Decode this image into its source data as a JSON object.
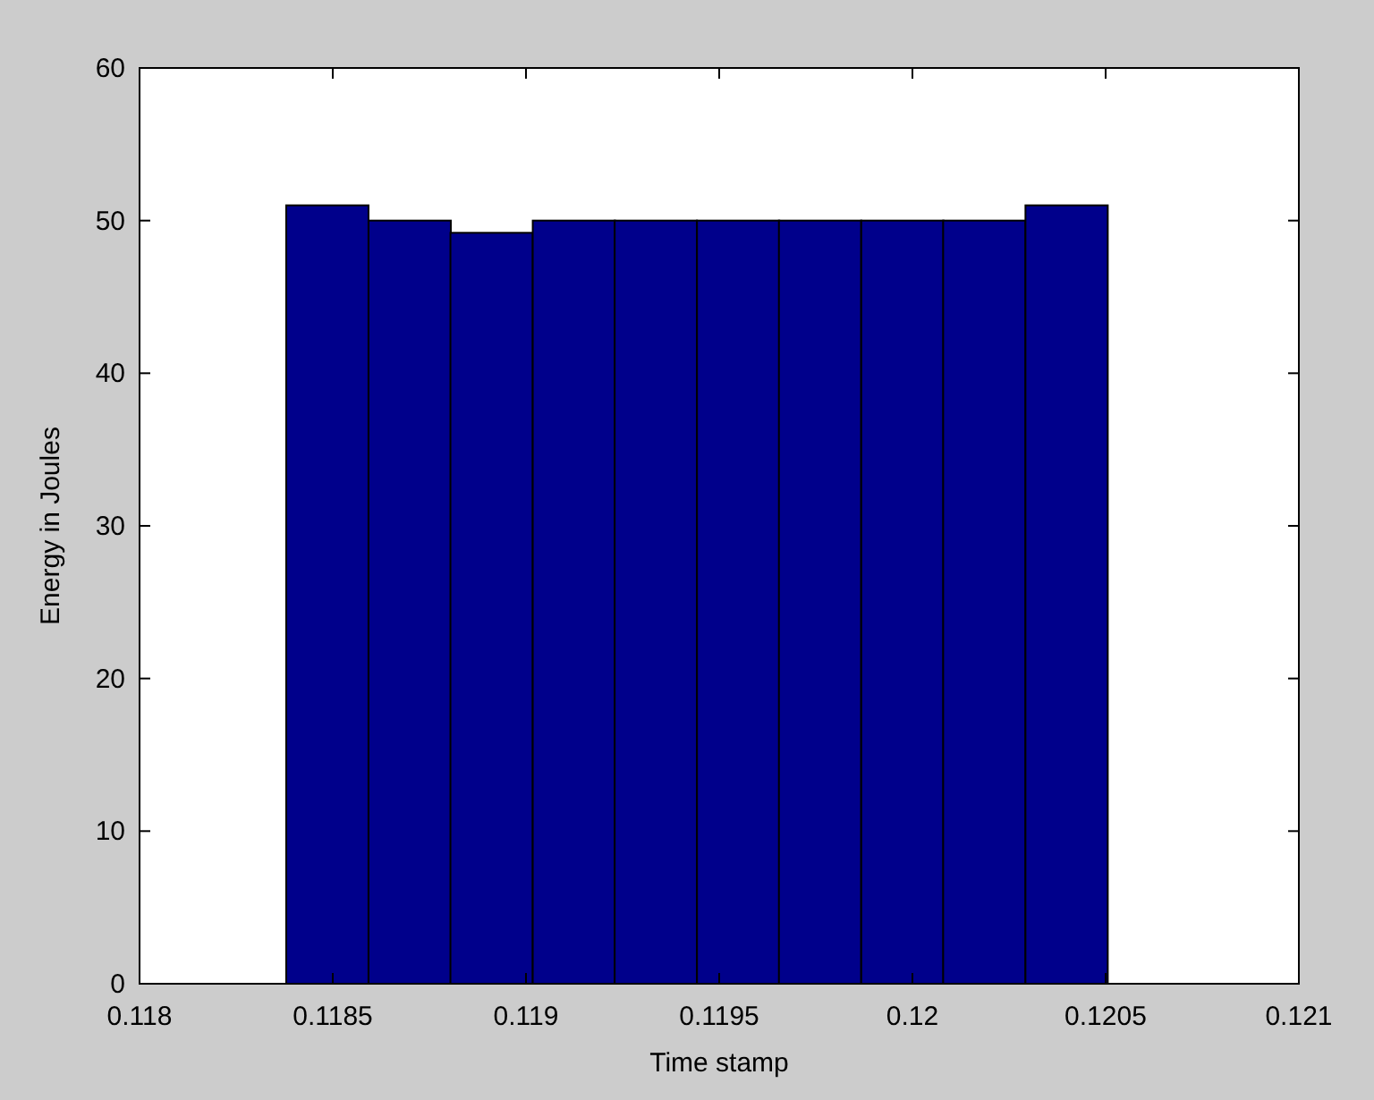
{
  "chart_data": {
    "type": "bar",
    "xlabel": "Time stamp",
    "ylabel": "Energy in Joules",
    "x": [
      0.118486,
      0.118699,
      0.118911,
      0.119124,
      0.119336,
      0.119549,
      0.119761,
      0.119974,
      0.120186,
      0.120399
    ],
    "series": [
      {
        "color": "#00008b",
        "values": [
          51,
          50,
          49.2,
          50,
          50,
          50,
          50,
          50,
          50,
          51
        ]
      }
    ],
    "xlim": [
      0.118,
      0.121
    ],
    "ylim": [
      0,
      60
    ],
    "xticks": [
      0.118,
      0.1185,
      0.119,
      0.1195,
      0.12,
      0.1205,
      0.121
    ],
    "yticks": [
      0,
      10,
      20,
      30,
      40,
      50,
      60
    ]
  }
}
